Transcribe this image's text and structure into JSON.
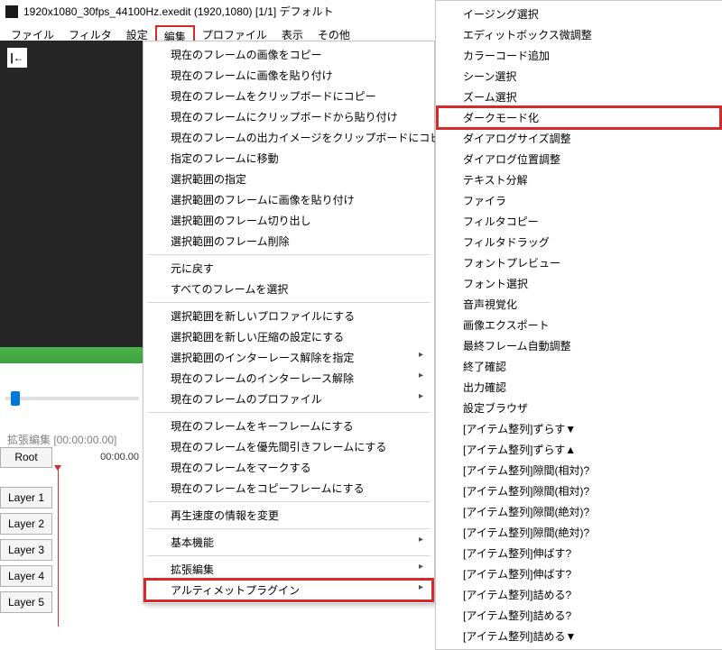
{
  "title": "1920x1080_30fps_44100Hz.exedit (1920,1080) [1/1] デフォルト",
  "menu": {
    "file": "ファイル",
    "filter": "フィルタ",
    "settings": "設定",
    "edit": "編集",
    "profile": "プロファイル",
    "view": "表示",
    "other": "その他"
  },
  "preview_icon": "|←",
  "timeline_label": "拡張編集 [00:00:00.00]",
  "root_label": "Root",
  "root_time": "00:00.00",
  "layers": [
    "Layer 1",
    "Layer 2",
    "Layer 3",
    "Layer 4",
    "Layer 5"
  ],
  "edit_menu": [
    {
      "label": "現在のフレームの画像をコピー"
    },
    {
      "label": "現在のフレームに画像を貼り付け"
    },
    {
      "label": "現在のフレームをクリップボードにコピー"
    },
    {
      "label": "現在のフレームにクリップボードから貼り付け"
    },
    {
      "label": "現在のフレームの出力イメージをクリップボードにコピー"
    },
    {
      "label": "指定のフレームに移動"
    },
    {
      "label": "選択範囲の指定"
    },
    {
      "label": "選択範囲のフレームに画像を貼り付け"
    },
    {
      "label": "選択範囲のフレーム切り出し"
    },
    {
      "label": "選択範囲のフレーム削除"
    },
    {
      "sep": true
    },
    {
      "label": "元に戻す"
    },
    {
      "label": "すべてのフレームを選択"
    },
    {
      "sep": true
    },
    {
      "label": "選択範囲を新しいプロファイルにする"
    },
    {
      "label": "選択範囲を新しい圧縮の設定にする"
    },
    {
      "label": "選択範囲のインターレース解除を指定",
      "arrow": true
    },
    {
      "label": "現在のフレームのインターレース解除",
      "arrow": true
    },
    {
      "label": "現在のフレームのプロファイル",
      "arrow": true
    },
    {
      "sep": true
    },
    {
      "label": "現在のフレームをキーフレームにする"
    },
    {
      "label": "現在のフレームを優先間引きフレームにする"
    },
    {
      "label": "現在のフレームをマークする"
    },
    {
      "label": "現在のフレームをコピーフレームにする"
    },
    {
      "sep": true
    },
    {
      "label": "再生速度の情報を変更"
    },
    {
      "sep": true
    },
    {
      "label": "基本機能",
      "arrow": true
    },
    {
      "sep": true
    },
    {
      "label": "拡張編集",
      "arrow": true
    },
    {
      "label": "アルティメットプラグイン",
      "arrow": true,
      "highlight": true
    }
  ],
  "submenu": [
    {
      "label": "イージング選択"
    },
    {
      "label": "エディットボックス微調整"
    },
    {
      "label": "カラーコード追加"
    },
    {
      "label": "シーン選択"
    },
    {
      "label": "ズーム選択"
    },
    {
      "label": "ダークモード化",
      "highlight": true
    },
    {
      "label": "ダイアログサイズ調整"
    },
    {
      "label": "ダイアログ位置調整"
    },
    {
      "label": "テキスト分解"
    },
    {
      "label": "ファイラ"
    },
    {
      "label": "フィルタコピー"
    },
    {
      "label": "フィルタドラッグ"
    },
    {
      "label": "フォントプレビュー"
    },
    {
      "label": "フォント選択"
    },
    {
      "label": "音声視覚化"
    },
    {
      "label": "画像エクスポート"
    },
    {
      "label": "最終フレーム自動調整"
    },
    {
      "label": "終了確認"
    },
    {
      "label": "出力確認"
    },
    {
      "label": "設定ブラウザ"
    },
    {
      "label": "[アイテム整列]ずらす▼"
    },
    {
      "label": "[アイテム整列]ずらす▲"
    },
    {
      "label": "[アイテム整列]隙間(相対)?"
    },
    {
      "label": "[アイテム整列]隙間(相対)?"
    },
    {
      "label": "[アイテム整列]隙間(絶対)?"
    },
    {
      "label": "[アイテム整列]隙間(絶対)?"
    },
    {
      "label": "[アイテム整列]伸ばす?"
    },
    {
      "label": "[アイテム整列]伸ばす?"
    },
    {
      "label": "[アイテム整列]詰める?"
    },
    {
      "label": "[アイテム整列]詰める?"
    },
    {
      "label": "[アイテム整列]詰める▼"
    }
  ]
}
